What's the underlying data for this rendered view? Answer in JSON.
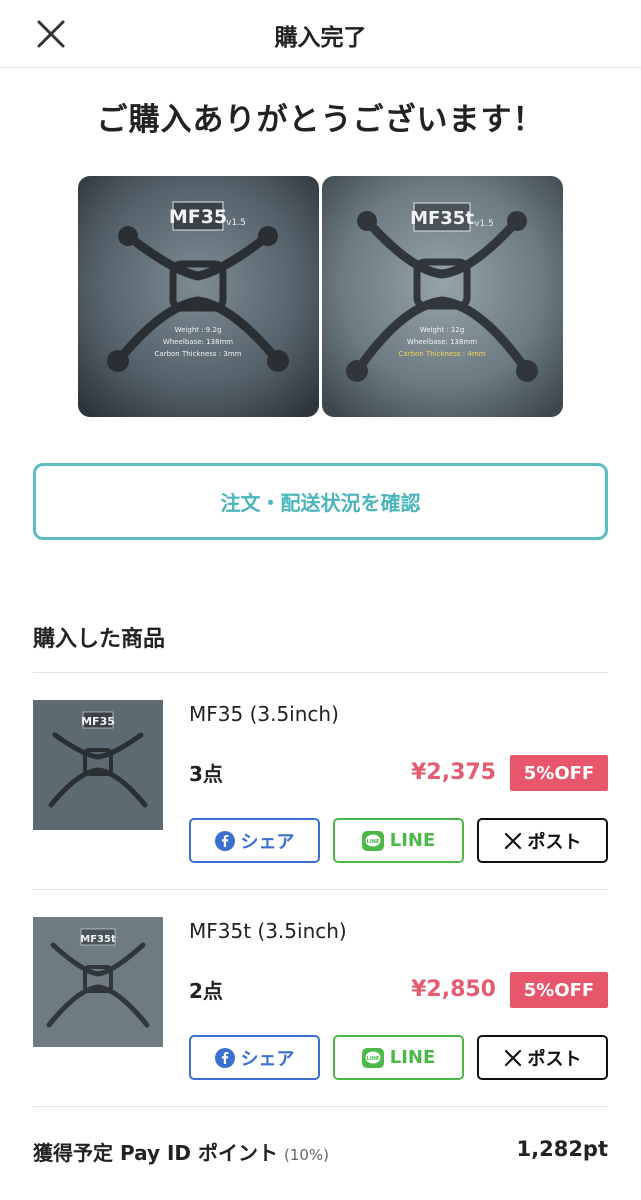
{
  "header": {
    "title": "購入完了"
  },
  "thanks_message": "ご購入ありがとうございます！",
  "hero_images": [
    {
      "model": "MF35",
      "version": "v1.5",
      "specs": [
        "Weight : 9.2g",
        "Wheelbase: 138mm",
        "Carbon Thickness : 3mm"
      ]
    },
    {
      "model": "MF35t",
      "version": "v1.5",
      "specs": [
        "Weight : 12g",
        "Wheelbase: 138mm",
        "Carbon Thickness : 4mm"
      ]
    }
  ],
  "order_status_button": "注文・配送状況を確認",
  "purchased_section_title": "購入した商品",
  "products": [
    {
      "name": "MF35 (3.5inch)",
      "qty": "3点",
      "price": "¥2,375",
      "discount": "5%OFF",
      "thumb_model": "MF35"
    },
    {
      "name": "MF35t (3.5inch)",
      "qty": "2点",
      "price": "¥2,850",
      "discount": "5%OFF",
      "thumb_model": "MF35t"
    }
  ],
  "share_buttons": {
    "facebook": "シェア",
    "line": "LINE",
    "x": "ポスト"
  },
  "points": {
    "label": "獲得予定 Pay ID ポイント",
    "rate": "(10%)",
    "value": "1,282pt"
  },
  "colors": {
    "accent_teal": "#5bbcc2",
    "price_red": "#e35c70",
    "badge_red": "#e8566c",
    "facebook_blue": "#3b6fd0",
    "line_green": "#4cb848"
  }
}
